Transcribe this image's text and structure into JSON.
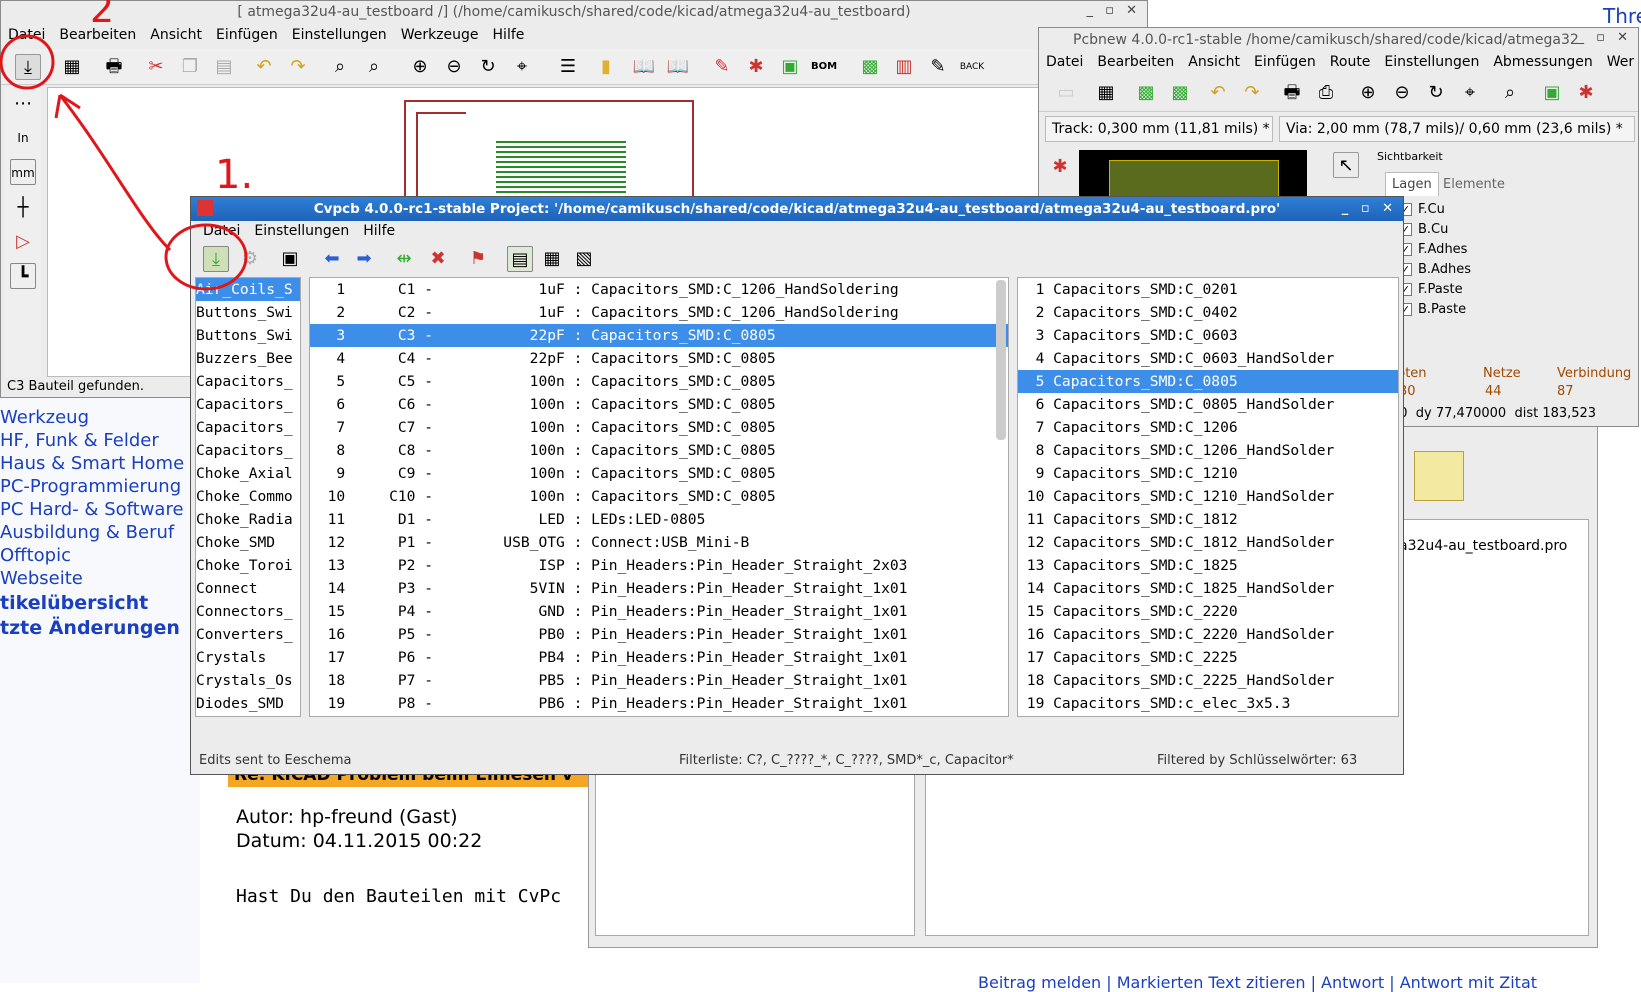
{
  "eeschema": {
    "title": "[ atmega32u4-au_testboard /] (/home/camikusch/shared/code/kicad/atmega32u4-au_testboard)",
    "menu": [
      "Datei",
      "Bearbeiten",
      "Ansicht",
      "Einfügen",
      "Einstellungen",
      "Werkzeuge",
      "Hilfe"
    ],
    "left_tools": [
      "In",
      "mm"
    ],
    "status": "C3 Bauteil gefunden."
  },
  "pcbnew": {
    "title": "Pcbnew 4.0.0-rc1-stable /home/camikusch/shared/code/kicad/atmega32",
    "menu": [
      "Datei",
      "Bearbeiten",
      "Ansicht",
      "Einfügen",
      "Route",
      "Einstellungen",
      "Abmessungen",
      "Wer"
    ],
    "track": "Track: 0,300 mm (11,81 mils) *",
    "via": "Via: 2,00 mm (78,7 mils)/ 0,60 mm (23,6 mils) *",
    "visibility_label": "Sichtbarkeit",
    "tabs": [
      "Lagen",
      "Elemente"
    ],
    "layers": [
      {
        "name": "F.Cu",
        "color": "#c0392b"
      },
      {
        "name": "B.Cu",
        "color": "#27ae60"
      },
      {
        "name": "F.Adhes",
        "color": "#8e44ad"
      },
      {
        "name": "B.Adhes",
        "color": "#1f3fa6"
      },
      {
        "name": "F.Paste",
        "color": "#a32020"
      },
      {
        "name": "B.Paste",
        "color": "#1aa3a3"
      }
    ],
    "stats_labels": [
      "noten",
      "Netze",
      "Verbindung"
    ],
    "stats_values": [
      "30",
      "44",
      "87"
    ],
    "coords": "00  dy 77,470000  dist 183,523",
    "project_file": "a32u4-au_testboard.pro"
  },
  "cvpcb": {
    "title": "Cvpcb 4.0.0-rc1-stable  Project: '/home/camikusch/shared/code/kicad/atmega32u4-au_testboard/atmega32u4-au_testboard.pro'",
    "menu": [
      "Datei",
      "Einstellungen",
      "Hilfe"
    ],
    "libraries": [
      "Air_Coils_S",
      "Buttons_Swi",
      "Buttons_Swi",
      "Buzzers_Bee",
      "Capacitors_",
      "Capacitors_",
      "Capacitors_",
      "Capacitors_",
      "Choke_Axial",
      "Choke_Commo",
      "Choke_Radia",
      "Choke_SMD",
      "Choke_Toroi",
      "Connect",
      "Connectors_",
      "Converters_",
      "Crystals",
      "Crystals_Os",
      "Diodes_SMD"
    ],
    "components": [
      "   1      C1 -            1uF : Capacitors_SMD:C_1206_HandSoldering",
      "   2      C2 -            1uF : Capacitors_SMD:C_1206_HandSoldering",
      "   3      C3 -           22pF : Capacitors_SMD:C_0805",
      "   4      C4 -           22pF : Capacitors_SMD:C_0805",
      "   5      C5 -           100n : Capacitors_SMD:C_0805",
      "   6      C6 -           100n : Capacitors_SMD:C_0805",
      "   7      C7 -           100n : Capacitors_SMD:C_0805",
      "   8      C8 -           100n : Capacitors_SMD:C_0805",
      "   9      C9 -           100n : Capacitors_SMD:C_0805",
      "  10     C10 -           100n : Capacitors_SMD:C_0805",
      "  11      D1 -            LED : LEDs:LED-0805",
      "  12      P1 -        USB_OTG : Connect:USB_Mini-B",
      "  13      P2 -            ISP : Pin_Headers:Pin_Header_Straight_2x03",
      "  14      P3 -           5VIN : Pin_Headers:Pin_Header_Straight_1x01",
      "  15      P4 -            GND : Pin_Headers:Pin_Header_Straight_1x01",
      "  16      P5 -            PB0 : Pin_Headers:Pin_Header_Straight_1x01",
      "  17      P6 -            PB4 : Pin_Headers:Pin_Header_Straight_1x01",
      "  18      P7 -            PB5 : Pin_Headers:Pin_Header_Straight_1x01",
      "  19      P8 -            PB6 : Pin_Headers:Pin_Header_Straight_1x01"
    ],
    "footprints": [
      "  1 Capacitors_SMD:C_0201",
      "  2 Capacitors_SMD:C_0402",
      "  3 Capacitors_SMD:C_0603",
      "  4 Capacitors_SMD:C_0603_HandSolder",
      "  5 Capacitors_SMD:C_0805",
      "  6 Capacitors_SMD:C_0805_HandSolder",
      "  7 Capacitors_SMD:C_1206",
      "  8 Capacitors_SMD:C_1206_HandSolder",
      "  9 Capacitors_SMD:C_1210",
      " 10 Capacitors_SMD:C_1210_HandSolder",
      " 11 Capacitors_SMD:C_1812",
      " 12 Capacitors_SMD:C_1812_HandSolder",
      " 13 Capacitors_SMD:C_1825",
      " 14 Capacitors_SMD:C_1825_HandSolder",
      " 15 Capacitors_SMD:C_2220",
      " 16 Capacitors_SMD:C_2220_HandSolder",
      " 17 Capacitors_SMD:C_2225",
      " 18 Capacitors_SMD:C_2225_HandSolder",
      " 19 Capacitors_SMD:c_elec_3x5.3"
    ],
    "status_left": "Edits sent to Eeschema",
    "status_mid": "Filterliste: C?, C_????_*, C_????, SMD*_c, Capacitor*",
    "status_right": "Filtered by Schlüsselwörter: 63"
  },
  "forum": {
    "nav": [
      "Werkzeug",
      "HF, Funk & Felder",
      "Haus & Smart Home",
      "PC-Programmierung",
      "PC Hard- & Software",
      "Ausbildung & Beruf",
      "Offtopic",
      "Webseite"
    ],
    "nav_bold": [
      "tikelübersicht",
      "tzte Änderungen"
    ],
    "post_title": "Re: KICAD Problem beim Einlesen v",
    "author": "Autor: hp-freund (Gast)",
    "date": "Datum: 04.11.2015 00:22",
    "body": "Hast Du den Bauteilen mit CvPc",
    "footer_links": [
      "Beitrag melden",
      "Markierten Text zitieren",
      "Antwort",
      "Antwort mit Zitat"
    ],
    "top_right": "Thre"
  },
  "annotations": {
    "one": "1.",
    "two": "2"
  }
}
